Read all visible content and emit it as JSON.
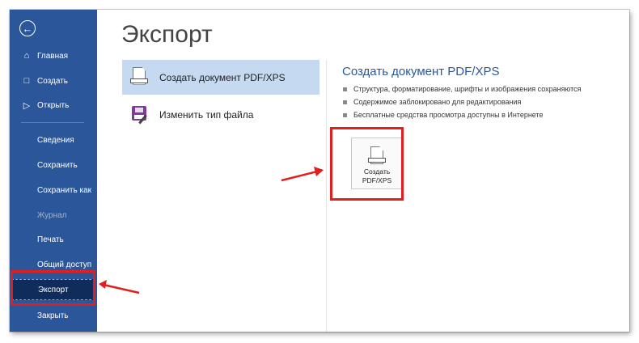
{
  "sidebar": {
    "back_icon": "back-arrow-icon",
    "items": [
      {
        "label": "Главная",
        "icon": "home-icon"
      },
      {
        "label": "Создать",
        "icon": "new-document-icon"
      },
      {
        "label": "Открыть",
        "icon": "open-folder-icon"
      },
      {
        "label": "Сведения"
      },
      {
        "label": "Сохранить"
      },
      {
        "label": "Сохранить как"
      },
      {
        "label": "Журнал",
        "disabled": true
      },
      {
        "label": "Печать"
      },
      {
        "label": "Общий доступ"
      },
      {
        "label": "Экспорт",
        "active": true
      },
      {
        "label": "Закрыть"
      }
    ]
  },
  "main": {
    "title": "Экспорт",
    "options": [
      {
        "label": "Создать документ PDF/XPS",
        "icon": "pdf-document-icon",
        "selected": true
      },
      {
        "label": "Изменить тип файла",
        "icon": "save-file-type-icon"
      }
    ],
    "detail": {
      "title": "Создать документ PDF/XPS",
      "bullets": [
        "Структура, форматирование, шрифты и изображения сохраняются",
        "Содержимое заблокировано для редактирования",
        "Бесплатные средства просмотра доступны в Интернете"
      ],
      "button_line1": "Создать",
      "button_line2": "PDF/XPS"
    }
  },
  "colors": {
    "sidebar": "#2b579a",
    "sidebar_active": "#0f2c5a",
    "selected_option": "#c5d9f1",
    "accent_text": "#2b579a",
    "annotation": "#e01f1f"
  }
}
